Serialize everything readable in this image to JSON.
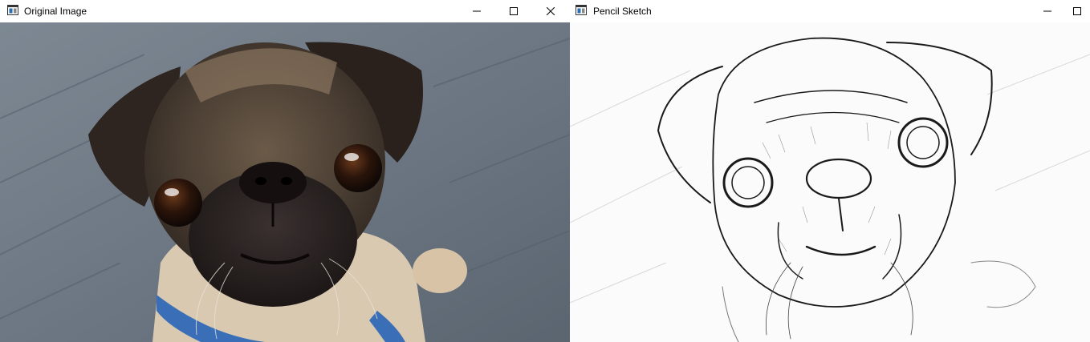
{
  "windows": [
    {
      "title": "Original Image",
      "icon": "image-viewer-icon",
      "controls": [
        "minimize",
        "maximize",
        "close"
      ]
    },
    {
      "title": "Pencil Sketch",
      "icon": "image-viewer-icon",
      "controls": [
        "minimize",
        "maximize"
      ]
    }
  ],
  "colors": {
    "titlebar": "#ffffff",
    "background_pavement": "#6a7480",
    "fur_light": "#d9c9b0",
    "fur_dark": "#2a2420",
    "collar": "#3a6fb8",
    "sketch_line": "#1a1a1a"
  }
}
